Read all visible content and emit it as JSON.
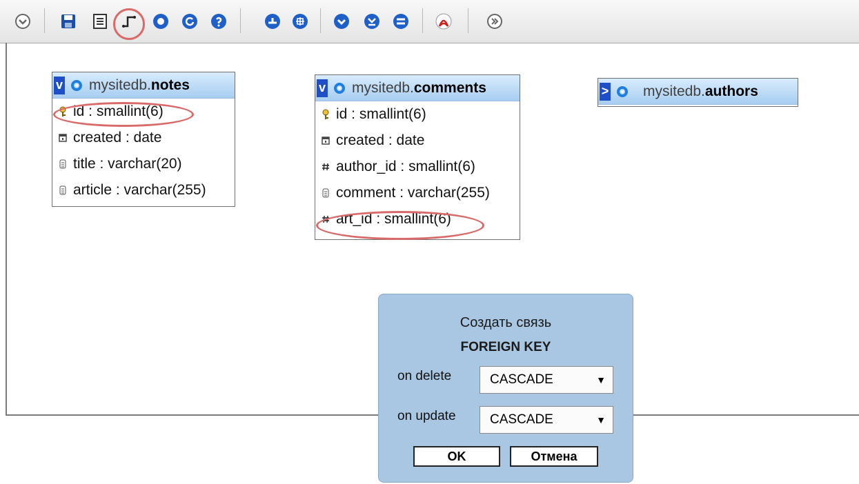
{
  "toolbar": {
    "buttons": [
      {
        "icon": "chevron-down-icon"
      },
      {
        "icon": "save-icon"
      },
      {
        "icon": "list-icon"
      },
      {
        "icon": "relation-icon"
      },
      {
        "icon": "circle-button-icon"
      },
      {
        "icon": "reload-icon"
      },
      {
        "icon": "help-icon"
      },
      {
        "icon": "angular-links-icon"
      },
      {
        "icon": "grid-icon"
      },
      {
        "icon": "expand-icon"
      },
      {
        "icon": "collapse-icon"
      },
      {
        "icon": "toggle-icon"
      },
      {
        "icon": "pdf-icon"
      },
      {
        "icon": "fullscreen-icon"
      }
    ]
  },
  "tables": {
    "notes": {
      "toggle": "v",
      "db": "mysitedb.",
      "name": "notes",
      "columns": [
        {
          "label": "id : smallint(6)",
          "icon": "key-icon"
        },
        {
          "label": "created : date",
          "icon": "calendar-icon"
        },
        {
          "label": "title : varchar(20)",
          "icon": "text-icon"
        },
        {
          "label": "article : varchar(255)",
          "icon": "text-icon"
        }
      ]
    },
    "comments": {
      "toggle": "v",
      "db": "mysitedb.",
      "name": "comments",
      "columns": [
        {
          "label": "id : smallint(6)",
          "icon": "key-icon"
        },
        {
          "label": "created : date",
          "icon": "calendar-icon"
        },
        {
          "label": "author_id : smallint(6)",
          "icon": "hash-icon"
        },
        {
          "label": "comment : varchar(255)",
          "icon": "text-icon"
        },
        {
          "label": "art_id : smallint(6)",
          "icon": "hash-icon"
        }
      ]
    },
    "authors": {
      "toggle": ">",
      "db": "mysitedb.",
      "name": "authors"
    }
  },
  "dialog": {
    "title": "Создать связь",
    "subtitle": "FOREIGN KEY",
    "on_delete_label": "on delete",
    "on_delete_value": "CASCADE",
    "on_update_label": "on update",
    "on_update_value": "CASCADE",
    "ok_label": "OK",
    "cancel_label": "Отмена"
  },
  "colors": {
    "header_blue": "#a7cdf1",
    "toggle_blue": "#1f4fc6",
    "dialog_bg": "#a9c7e3",
    "highlight_red": "#d96a6a"
  }
}
